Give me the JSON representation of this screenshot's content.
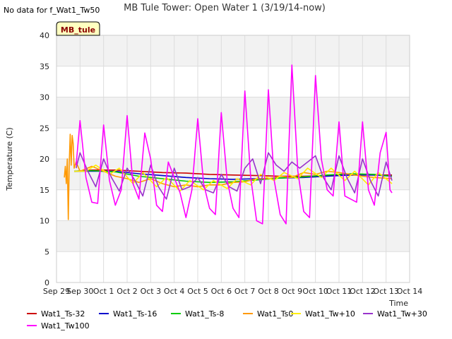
{
  "page": {
    "note": "No data for f_Wat1_Tw50",
    "station_badge": "MB_tule"
  },
  "chart_data": {
    "type": "line",
    "title": "MB Tule Tower: Open Water 1 (3/19/14-now)",
    "xlabel": "Time",
    "ylabel": "Temperature (C)",
    "x_ticks": [
      "Sep 29",
      "Sep 30",
      "Oct 1",
      "Oct 2",
      "Oct 3",
      "Oct 4",
      "Oct 5",
      "Oct 6",
      "Oct 7",
      "Oct 8",
      "Oct 9",
      "Oct 10",
      "Oct 11",
      "Oct 12",
      "Oct 13",
      "Oct 14"
    ],
    "xlim": [
      "2014-09-29",
      "2014-10-14"
    ],
    "ylim": [
      0,
      40
    ],
    "y_ticks": [
      0,
      5,
      10,
      15,
      20,
      25,
      30,
      35,
      40
    ],
    "grid": true,
    "legend_position": "bottom",
    "series": [
      {
        "name": "Wat1_Ts-32",
        "color": "#cc0000",
        "points": [
          [
            "2014-09-29 18:00",
            18.0
          ],
          [
            "2014-09-30 12:00",
            18.2
          ],
          [
            "2014-10-01 12:00",
            18.2
          ],
          [
            "2014-10-02 12:00",
            18.0
          ],
          [
            "2014-10-03 12:00",
            17.8
          ],
          [
            "2014-10-04 12:00",
            17.7
          ],
          [
            "2014-10-05 12:00",
            17.5
          ],
          [
            "2014-10-06 12:00",
            17.4
          ],
          [
            "2014-10-07 12:00",
            17.3
          ],
          [
            "2014-10-08 12:00",
            17.2
          ],
          [
            "2014-10-09 12:00",
            17.2
          ],
          [
            "2014-10-10 12:00",
            17.3
          ],
          [
            "2014-10-11 12:00",
            17.4
          ],
          [
            "2014-10-12 12:00",
            17.4
          ],
          [
            "2014-10-13 06:00",
            17.4
          ]
        ]
      },
      {
        "name": "Wat1_Ts-16",
        "color": "#0000cc",
        "points": [
          [
            "2014-09-29 18:00",
            18.0
          ],
          [
            "2014-09-30 12:00",
            18.0
          ],
          [
            "2014-10-01 12:00",
            18.0
          ],
          [
            "2014-10-02 12:00",
            17.6
          ],
          [
            "2014-10-03 12:00",
            17.3
          ],
          [
            "2014-10-04 12:00",
            17.0
          ],
          [
            "2014-10-05 12:00",
            16.8
          ],
          [
            "2014-10-06 12:00",
            16.7
          ],
          [
            "2014-10-07 12:00",
            16.8
          ],
          [
            "2014-10-08 12:00",
            16.9
          ],
          [
            "2014-10-09 12:00",
            17.0
          ],
          [
            "2014-10-10 12:00",
            17.2
          ],
          [
            "2014-10-11 12:00",
            17.4
          ],
          [
            "2014-10-12 12:00",
            17.4
          ],
          [
            "2014-10-13 06:00",
            17.2
          ]
        ]
      },
      {
        "name": "Wat1_Ts-8",
        "color": "#00cc00",
        "points": [
          [
            "2014-09-29 18:00",
            18.0
          ],
          [
            "2014-09-30 12:00",
            18.1
          ],
          [
            "2014-10-01 12:00",
            17.9
          ],
          [
            "2014-10-02 12:00",
            17.2
          ],
          [
            "2014-10-03 12:00",
            16.8
          ],
          [
            "2014-10-04 12:00",
            16.4
          ],
          [
            "2014-10-05 12:00",
            16.2
          ],
          [
            "2014-10-06 12:00",
            16.3
          ],
          [
            "2014-10-07 12:00",
            16.6
          ],
          [
            "2014-10-08 12:00",
            16.9
          ],
          [
            "2014-10-09 12:00",
            17.1
          ],
          [
            "2014-10-10 12:00",
            17.4
          ],
          [
            "2014-10-11 12:00",
            17.6
          ],
          [
            "2014-10-12 12:00",
            17.5
          ],
          [
            "2014-10-13 06:00",
            17.2
          ]
        ]
      },
      {
        "name": "Wat1_Ts0",
        "color": "#ff9900",
        "points": [
          [
            "2014-09-29 08:00",
            17.0
          ],
          [
            "2014-09-29 09:00",
            18.8
          ],
          [
            "2014-09-29 10:00",
            16.0
          ],
          [
            "2014-09-29 11:00",
            20.0
          ],
          [
            "2014-09-29 12:00",
            10.2
          ],
          [
            "2014-09-29 13:00",
            19.5
          ],
          [
            "2014-09-29 14:00",
            24.0
          ],
          [
            "2014-09-29 15:00",
            19.0
          ],
          [
            "2014-09-29 16:00",
            23.8
          ],
          [
            "2014-09-29 17:00",
            22.5
          ],
          [
            "2014-09-29 18:00",
            18.5
          ],
          [
            "2014-09-29 20:00",
            19.5
          ],
          [
            "2014-09-30 00:00",
            18.0
          ],
          [
            "2014-09-30 12:00",
            18.8
          ],
          [
            "2014-10-01 00:00",
            18.0
          ],
          [
            "2014-10-01 12:00",
            17.2
          ],
          [
            "2014-10-02 00:00",
            16.8
          ],
          [
            "2014-10-02 12:00",
            16.2
          ],
          [
            "2014-10-03 00:00",
            16.8
          ],
          [
            "2014-10-03 12:00",
            16.0
          ],
          [
            "2014-10-04 00:00",
            15.5
          ],
          [
            "2014-10-04 12:00",
            15.8
          ],
          [
            "2014-10-05 00:00",
            15.5
          ],
          [
            "2014-10-05 12:00",
            15.8
          ],
          [
            "2014-10-06 00:00",
            15.8
          ],
          [
            "2014-10-06 12:00",
            16.2
          ],
          [
            "2014-10-07 00:00",
            16.3
          ],
          [
            "2014-10-07 12:00",
            16.8
          ],
          [
            "2014-10-08 00:00",
            16.8
          ],
          [
            "2014-10-08 12:00",
            17.2
          ],
          [
            "2014-10-09 00:00",
            17.0
          ],
          [
            "2014-10-09 12:00",
            17.8
          ],
          [
            "2014-10-10 00:00",
            17.5
          ],
          [
            "2014-10-10 12:00",
            18.0
          ],
          [
            "2014-10-11 00:00",
            17.8
          ],
          [
            "2014-10-11 12:00",
            17.5
          ],
          [
            "2014-10-12 00:00",
            17.2
          ],
          [
            "2014-10-12 12:00",
            17.0
          ],
          [
            "2014-10-13 06:00",
            16.8
          ]
        ]
      },
      {
        "name": "Wat1_Tw+10",
        "color": "#ffee00",
        "points": [
          [
            "2014-09-29 18:00",
            18.0
          ],
          [
            "2014-09-30 06:00",
            18.0
          ],
          [
            "2014-09-30 16:00",
            19.0
          ],
          [
            "2014-10-01 06:00",
            17.5
          ],
          [
            "2014-10-01 16:00",
            18.5
          ],
          [
            "2014-10-02 06:00",
            16.0
          ],
          [
            "2014-10-02 16:00",
            17.8
          ],
          [
            "2014-10-03 06:00",
            15.5
          ],
          [
            "2014-10-03 16:00",
            17.0
          ],
          [
            "2014-10-04 06:00",
            14.8
          ],
          [
            "2014-10-04 16:00",
            16.5
          ],
          [
            "2014-10-05 06:00",
            15.0
          ],
          [
            "2014-10-05 16:00",
            16.5
          ],
          [
            "2014-10-06 06:00",
            15.2
          ],
          [
            "2014-10-06 16:00",
            16.8
          ],
          [
            "2014-10-07 06:00",
            15.8
          ],
          [
            "2014-10-07 16:00",
            17.5
          ],
          [
            "2014-10-08 06:00",
            16.5
          ],
          [
            "2014-10-08 16:00",
            17.8
          ],
          [
            "2014-10-09 06:00",
            16.8
          ],
          [
            "2014-10-09 16:00",
            18.5
          ],
          [
            "2014-10-10 06:00",
            17.0
          ],
          [
            "2014-10-10 16:00",
            18.5
          ],
          [
            "2014-10-11 06:00",
            16.5
          ],
          [
            "2014-10-11 16:00",
            18.0
          ],
          [
            "2014-10-12 06:00",
            15.8
          ],
          [
            "2014-10-12 16:00",
            17.8
          ],
          [
            "2014-10-13 06:00",
            16.0
          ],
          [
            "2014-10-13 06:00",
            16.0
          ]
        ]
      },
      {
        "name": "Wat1_Tw+30",
        "color": "#9933cc",
        "points": [
          [
            "2014-09-29 20:00",
            18.5
          ],
          [
            "2014-09-30 00:00",
            21.0
          ],
          [
            "2014-09-30 08:00",
            18.0
          ],
          [
            "2014-09-30 16:00",
            15.5
          ],
          [
            "2014-10-01 00:00",
            20.0
          ],
          [
            "2014-10-01 08:00",
            17.0
          ],
          [
            "2014-10-01 16:00",
            14.8
          ],
          [
            "2014-10-02 00:00",
            18.5
          ],
          [
            "2014-10-02 08:00",
            16.5
          ],
          [
            "2014-10-02 16:00",
            14.0
          ],
          [
            "2014-10-03 00:00",
            19.0
          ],
          [
            "2014-10-03 08:00",
            15.5
          ],
          [
            "2014-10-03 16:00",
            13.5
          ],
          [
            "2014-10-04 00:00",
            18.5
          ],
          [
            "2014-10-04 08:00",
            15.0
          ],
          [
            "2014-10-04 16:00",
            15.5
          ],
          [
            "2014-10-05 00:00",
            17.0
          ],
          [
            "2014-10-05 08:00",
            15.0
          ],
          [
            "2014-10-05 16:00",
            14.5
          ],
          [
            "2014-10-06 00:00",
            17.5
          ],
          [
            "2014-10-06 08:00",
            15.5
          ],
          [
            "2014-10-06 16:00",
            14.8
          ],
          [
            "2014-10-07 00:00",
            18.5
          ],
          [
            "2014-10-07 08:00",
            20.0
          ],
          [
            "2014-10-07 16:00",
            16.0
          ],
          [
            "2014-10-08 00:00",
            21.0
          ],
          [
            "2014-10-08 08:00",
            19.0
          ],
          [
            "2014-10-08 16:00",
            18.0
          ],
          [
            "2014-10-09 00:00",
            19.5
          ],
          [
            "2014-10-09 08:00",
            18.5
          ],
          [
            "2014-10-09 16:00",
            19.5
          ],
          [
            "2014-10-10 00:00",
            20.5
          ],
          [
            "2014-10-10 08:00",
            17.0
          ],
          [
            "2014-10-10 16:00",
            15.0
          ],
          [
            "2014-10-11 00:00",
            20.5
          ],
          [
            "2014-10-11 08:00",
            17.0
          ],
          [
            "2014-10-11 16:00",
            14.5
          ],
          [
            "2014-10-12 00:00",
            20.0
          ],
          [
            "2014-10-12 08:00",
            16.5
          ],
          [
            "2014-10-12 16:00",
            14.0
          ],
          [
            "2014-10-13 00:00",
            19.5
          ],
          [
            "2014-10-13 06:00",
            16.5
          ]
        ]
      },
      {
        "name": "Wat1_Tw100",
        "color": "#ff00ff",
        "points": [
          [
            "2014-09-29 20:00",
            19.0
          ],
          [
            "2014-09-30 00:00",
            26.2
          ],
          [
            "2014-09-30 06:00",
            17.0
          ],
          [
            "2014-09-30 12:00",
            13.0
          ],
          [
            "2014-09-30 18:00",
            12.8
          ],
          [
            "2014-10-01 00:00",
            25.5
          ],
          [
            "2014-10-01 06:00",
            16.5
          ],
          [
            "2014-10-01 12:00",
            12.5
          ],
          [
            "2014-10-01 18:00",
            15.0
          ],
          [
            "2014-10-02 00:00",
            27.0
          ],
          [
            "2014-10-02 06:00",
            16.0
          ],
          [
            "2014-10-02 12:00",
            13.5
          ],
          [
            "2014-10-02 18:00",
            24.2
          ],
          [
            "2014-10-03 00:00",
            20.0
          ],
          [
            "2014-10-03 06:00",
            12.5
          ],
          [
            "2014-10-03 12:00",
            11.5
          ],
          [
            "2014-10-03 18:00",
            19.5
          ],
          [
            "2014-10-04 00:00",
            17.0
          ],
          [
            "2014-10-04 06:00",
            14.5
          ],
          [
            "2014-10-04 12:00",
            10.5
          ],
          [
            "2014-10-04 18:00",
            15.0
          ],
          [
            "2014-10-05 00:00",
            26.5
          ],
          [
            "2014-10-05 06:00",
            16.0
          ],
          [
            "2014-10-05 12:00",
            12.0
          ],
          [
            "2014-10-05 18:00",
            11.0
          ],
          [
            "2014-10-06 00:00",
            27.5
          ],
          [
            "2014-10-06 06:00",
            16.5
          ],
          [
            "2014-10-06 12:00",
            12.0
          ],
          [
            "2014-10-06 18:00",
            10.5
          ],
          [
            "2014-10-07 00:00",
            31.0
          ],
          [
            "2014-10-07 06:00",
            17.0
          ],
          [
            "2014-10-07 12:00",
            10.0
          ],
          [
            "2014-10-07 18:00",
            9.5
          ],
          [
            "2014-10-08 00:00",
            31.2
          ],
          [
            "2014-10-08 06:00",
            16.5
          ],
          [
            "2014-10-08 12:00",
            11.0
          ],
          [
            "2014-10-08 18:00",
            9.5
          ],
          [
            "2014-10-09 00:00",
            35.2
          ],
          [
            "2014-10-09 06:00",
            18.0
          ],
          [
            "2014-10-09 12:00",
            11.5
          ],
          [
            "2014-10-09 18:00",
            10.5
          ],
          [
            "2014-10-10 00:00",
            33.5
          ],
          [
            "2014-10-10 06:00",
            20.0
          ],
          [
            "2014-10-10 12:00",
            15.0
          ],
          [
            "2014-10-10 18:00",
            14.0
          ],
          [
            "2014-10-11 00:00",
            26.0
          ],
          [
            "2014-10-11 06:00",
            14.0
          ],
          [
            "2014-10-11 12:00",
            13.5
          ],
          [
            "2014-10-11 18:00",
            13.0
          ],
          [
            "2014-10-12 00:00",
            26.0
          ],
          [
            "2014-10-12 06:00",
            15.0
          ],
          [
            "2014-10-12 12:00",
            12.5
          ],
          [
            "2014-10-12 18:00",
            21.0
          ],
          [
            "2014-10-13 00:00",
            24.3
          ],
          [
            "2014-10-13 04:00",
            15.0
          ],
          [
            "2014-10-13 06:00",
            14.5
          ]
        ]
      }
    ]
  }
}
